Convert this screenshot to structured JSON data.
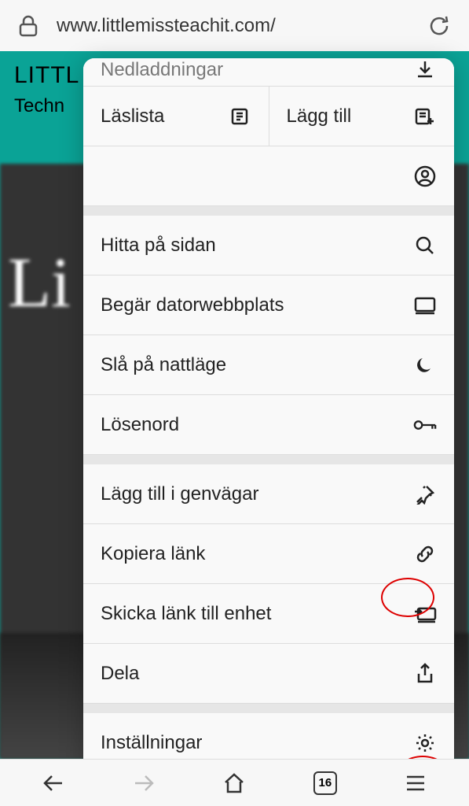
{
  "addressBar": {
    "url": "www.littlemissteachit.com/"
  },
  "background": {
    "siteTitle": "LITTL",
    "tagline": "Techn",
    "heroText": "Li"
  },
  "menu": {
    "partialTop": "Nedladdningar",
    "readingList": "Läslista",
    "addTo": "Lägg till",
    "findOnPage": "Hitta på sidan",
    "requestDesktop": "Begär datorwebbplats",
    "nightMode": "Slå på nattläge",
    "passwords": "Lösenord",
    "addToShortcuts": "Lägg till i genvägar",
    "copyLink": "Kopiera länk",
    "sendToDevice": "Skicka länk till enhet",
    "share": "Dela",
    "settings": "Inställningar"
  },
  "bottomBar": {
    "tabCount": "16"
  }
}
